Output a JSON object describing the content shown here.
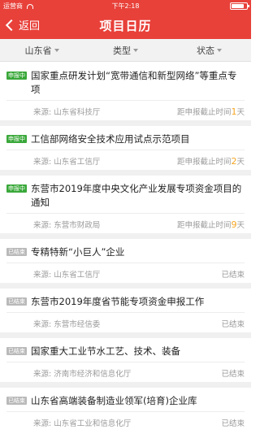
{
  "status_bar": {
    "carrier": "运营商",
    "time": "下午2:18",
    "battery_level": 0.85
  },
  "nav": {
    "back_label": "返回",
    "title": "项目日历"
  },
  "filters": [
    {
      "label": "山东省"
    },
    {
      "label": "类型"
    },
    {
      "label": "状态"
    }
  ],
  "items": [
    {
      "badge": "申报中",
      "state": "active",
      "title": "国家重点研发计划“宽带通信和新型网络”等重点专项",
      "source": "来源: 山东省科技厅",
      "deadline_prefix": "距申报截止时间",
      "days": "1",
      "deadline_suffix": "天"
    },
    {
      "badge": "申报中",
      "state": "active",
      "title": "工信部网络安全技术应用试点示范项目",
      "source": "来源: 山东省工信厅",
      "deadline_prefix": "距申报截止时间",
      "days": "2",
      "deadline_suffix": "天"
    },
    {
      "badge": "申报中",
      "state": "active",
      "title": "东营市2019年度中央文化产业发展专项资金项目的通知",
      "source": "来源: 东营市财政局",
      "deadline_prefix": "距申报截止时间",
      "days": "9",
      "deadline_suffix": "天"
    },
    {
      "badge": "已结束",
      "state": "closed",
      "title": "专精特新“小巨人”企业",
      "source": "来源: 山东省工信厅",
      "status": "已结束"
    },
    {
      "badge": "已结束",
      "state": "closed",
      "title": "东营市2019年度省节能专项资金申报工作",
      "source": "来源: 东营市经信委",
      "status": "已结束"
    },
    {
      "badge": "已结束",
      "state": "closed",
      "title": "国家重大工业节水工艺、技术、装备",
      "source": "来源: 济南市经济和信息化厅",
      "status": "已结束"
    },
    {
      "badge": "已结束",
      "state": "closed",
      "title": "山东省高端装备制造业领军(培育)企业库",
      "source": "来源: 山东省工业和信息化厅",
      "status": "已结束"
    }
  ]
}
